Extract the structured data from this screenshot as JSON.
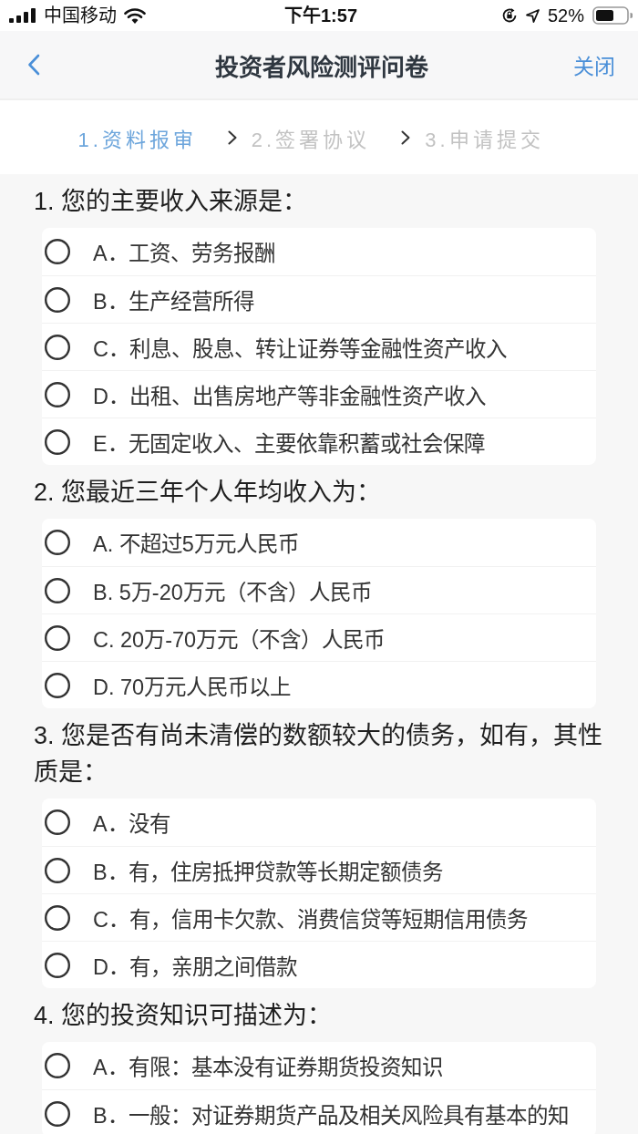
{
  "status_bar": {
    "carrier": "中国移动",
    "time": "下午1:57",
    "battery": "52%"
  },
  "nav_bar": {
    "title": "投资者风险测评问卷",
    "close": "关闭"
  },
  "steps": [
    {
      "label": "1.资料报审",
      "active": true
    },
    {
      "label": "2.签署协议",
      "active": false
    },
    {
      "label": "3.申请提交",
      "active": false
    }
  ],
  "questions": [
    {
      "title": "1. 您的主要收入来源是：",
      "options": [
        {
          "label": "A．工资、劳务报酬",
          "selected": false
        },
        {
          "label": "B．生产经营所得",
          "selected": false
        },
        {
          "label": "C．利息、股息、转让证券等金融性资产收入",
          "selected": false
        },
        {
          "label": "D．出租、出售房地产等非金融性资产收入",
          "selected": false
        },
        {
          "label": "E．无固定收入、主要依靠积蓄或社会保障",
          "selected": false
        }
      ]
    },
    {
      "title": "2. 您最近三年个人年均收入为：",
      "options": [
        {
          "label": "A. 不超过5万元人民币",
          "selected": false
        },
        {
          "label": "B. 5万-20万元（不含）人民币",
          "selected": false
        },
        {
          "label": "C. 20万-70万元（不含）人民币",
          "selected": false
        },
        {
          "label": "D. 70万元人民币以上",
          "selected": false
        }
      ]
    },
    {
      "title": "3. 您是否有尚未清偿的数额较大的债务，如有，其性质是：",
      "options": [
        {
          "label": "A．没有",
          "selected": false
        },
        {
          "label": "B．有，住房抵押贷款等长期定额债务",
          "selected": false
        },
        {
          "label": "C．有，信用卡欠款、消费信贷等短期信用债务",
          "selected": false
        },
        {
          "label": "D．有，亲朋之间借款",
          "selected": false
        }
      ]
    },
    {
      "title": "4. 您的投资知识可描述为：",
      "options": [
        {
          "label": "A．有限：基本没有证券期货投资知识",
          "selected": false
        },
        {
          "label": "B．一般：对证券期货产品及相关风险具有基本的知",
          "selected": false
        }
      ]
    }
  ]
}
